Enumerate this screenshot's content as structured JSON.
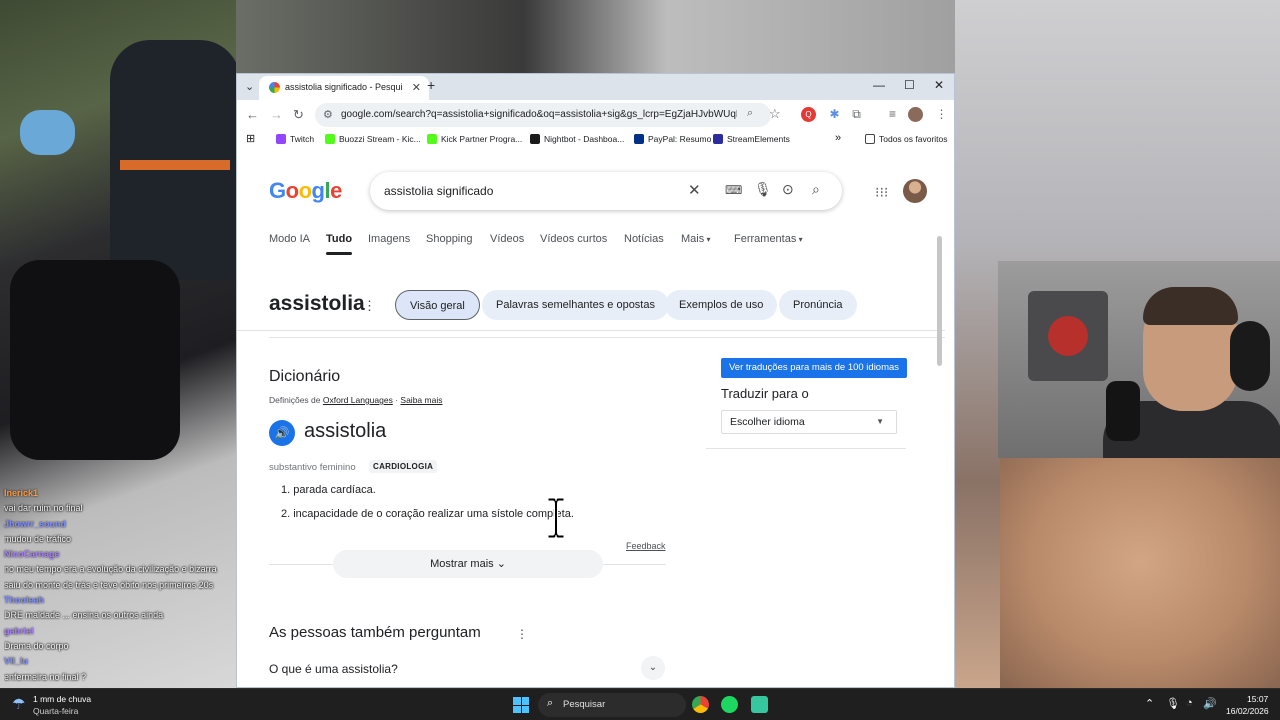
{
  "browser": {
    "tab_title": "assistolia significado - Pesquisa",
    "url": "google.com/search?q=assistolia+significado&oq=assistolia+sig&gs_lcrp=EgZjaHJvbWUqDAg...",
    "bookmarks": [
      {
        "label": "Twitch",
        "color": "#9146ff"
      },
      {
        "label": "Buozzi Stream - Kic...",
        "color": "#53fc18"
      },
      {
        "label": "Kick Partner Progra...",
        "color": "#53fc18"
      },
      {
        "label": "Nightbot - Dashboa...",
        "color": "#1b1b1b"
      },
      {
        "label": "PayPal: Resumo",
        "color": "#003087"
      },
      {
        "label": "StreamElements",
        "color": "#2c2c9c"
      }
    ],
    "bookmarks_more": "»",
    "all_bookmarks": "Todos os favoritos"
  },
  "google": {
    "query": "assistolia significado",
    "tabs": [
      "Modo IA",
      "Tudo",
      "Imagens",
      "Shopping",
      "Vídeos",
      "Vídeos curtos",
      "Notícias",
      "Mais",
      "Ferramentas"
    ],
    "active_tab": "Tudo",
    "term": "assistolia",
    "chips": [
      "Visão geral",
      "Palavras semelhantes e opostas",
      "Exemplos de uso",
      "Pronúncia"
    ],
    "dictionary": {
      "title": "Dicionário",
      "source_prefix": "Definições de",
      "source_name": "Oxford Languages",
      "learn_more": "Saiba mais",
      "word": "assistolia",
      "pos": "substantivo feminino",
      "domain": "CARDIOLOGIA",
      "definitions": [
        "1. parada cardíaca.",
        "2. incapacidade de o coração realizar uma sístole completa."
      ],
      "feedback": "Feedback",
      "show_more": "Mostrar mais"
    },
    "translate": {
      "badge": "Ver traduções para mais de 100 idiomas",
      "label": "Traduzir para o",
      "select": "Escolher idioma"
    },
    "paa": {
      "title": "As pessoas também perguntam",
      "q1": "O que é uma assistolia?"
    }
  },
  "chat": [
    {
      "user": "Inerick1",
      "color": "#ff9a3c",
      "text": "vai dar ruim no final"
    },
    {
      "user": "Jhowrr_sound",
      "color": "#7d8cff",
      "text": "mudou de tráfico"
    },
    {
      "user": "NicoCarnage",
      "color": "#a67dff",
      "text": "no meu tempo era a evolução da civilização e bizarra"
    },
    {
      "user": "",
      "color": "#ffffff",
      "text": "saiu do monte de trás e teve óbito nos primeiros 20s"
    },
    {
      "user": "Thooleah",
      "color": "#7d8cff",
      "text": "DRE maldade ... ensina os outros ainda"
    },
    {
      "user": "gabriel",
      "color": "#a67dff",
      "text": "Drama do corpo"
    },
    {
      "user": "VII_lu",
      "color": "#7d8cff",
      "text": "enfermeira no final ?"
    }
  ],
  "taskbar": {
    "weather_line1": "1 mm de chuva",
    "weather_line2": "Quarta-feira",
    "search": "Pesquisar",
    "time": "15:07",
    "date": "16/02/2026"
  }
}
